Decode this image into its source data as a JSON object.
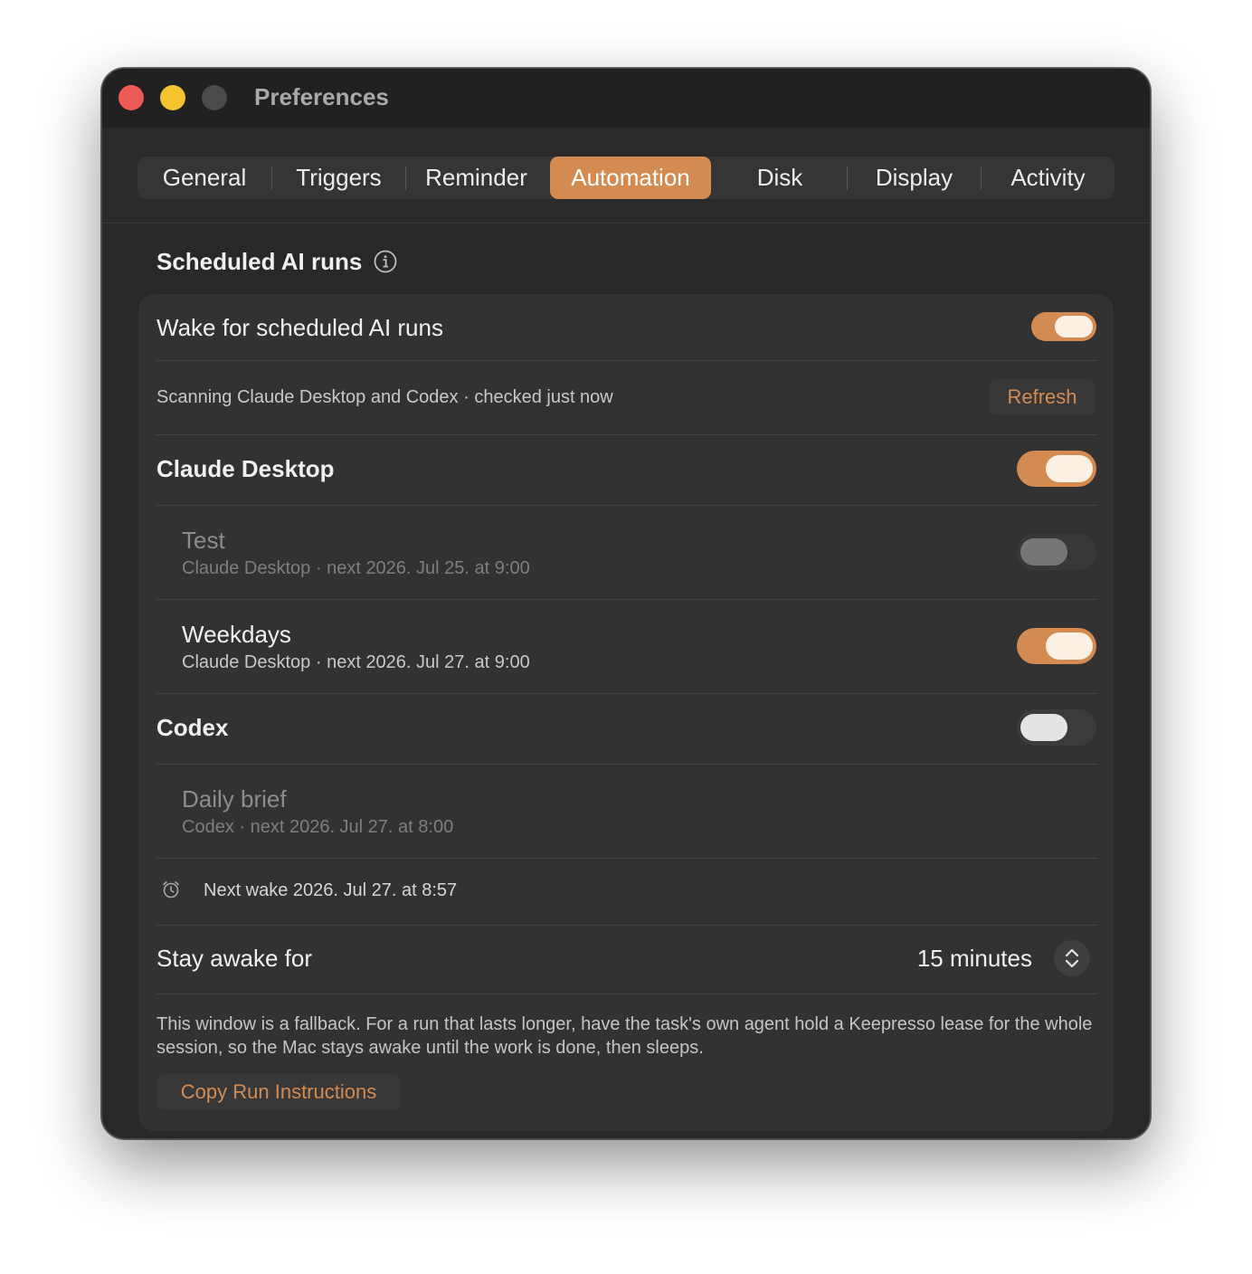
{
  "window": {
    "title": "Preferences"
  },
  "tabs": [
    {
      "label": "General"
    },
    {
      "label": "Triggers"
    },
    {
      "label": "Reminder"
    },
    {
      "label": "Automation",
      "active": true
    },
    {
      "label": "Disk"
    },
    {
      "label": "Display"
    },
    {
      "label": "Activity"
    }
  ],
  "section": {
    "title": "Scheduled AI runs",
    "info_icon": "info-circle-icon"
  },
  "wake": {
    "label": "Wake for scheduled AI runs",
    "enabled": true
  },
  "scan": {
    "status": "Scanning Claude Desktop and Codex · checked just now",
    "refresh_label": "Refresh"
  },
  "apps": {
    "claude": {
      "name": "Claude Desktop",
      "enabled": true,
      "tasks": [
        {
          "name": "Test",
          "detail": "Claude Desktop · next 2026. Jul 25. at 9:00",
          "enabled": false,
          "disabled": true
        },
        {
          "name": "Weekdays",
          "detail": "Claude Desktop · next 2026. Jul 27. at 9:00",
          "enabled": true
        }
      ]
    },
    "codex": {
      "name": "Codex",
      "enabled": false,
      "tasks": [
        {
          "name": "Daily brief",
          "detail": "Codex · next 2026. Jul 27. at 8:00"
        }
      ]
    }
  },
  "next_wake": {
    "icon": "alarm-clock-icon",
    "text": "Next wake 2026. Jul 27. at 8:57"
  },
  "stay_awake": {
    "label": "Stay awake for",
    "value": "15 minutes",
    "icon": "chevron-up-down-icon"
  },
  "note": "This window is a fallback. For a run that lasts longer, have the task's own agent hold a Keepresso lease for the whole session, so the Mac stays awake until the work is done, then sleeps.",
  "copy_button": "Copy Run Instructions",
  "colors": {
    "accent": "#d38b51",
    "window_bg": "#282828",
    "card_bg": "#323232"
  }
}
